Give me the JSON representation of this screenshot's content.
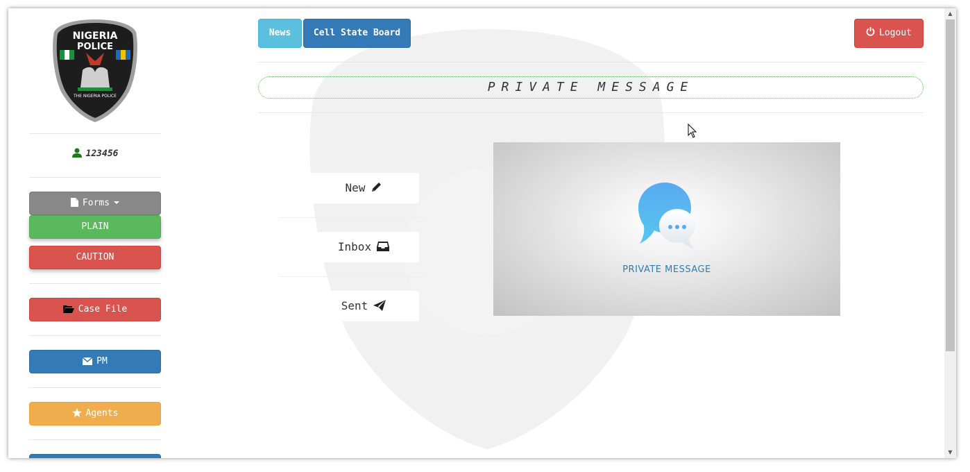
{
  "sidebar": {
    "user_id": "123456",
    "forms_label": "Forms",
    "forms_items": [
      "PLAIN",
      "CAUTION"
    ],
    "case_file_label": "Case File",
    "pm_label": "PM",
    "agents_label": "Agents",
    "logo_text_top": "NIGERIA",
    "logo_text_mid": "POLICE",
    "logo_text_bottom": "THE NIGERIA POLICE"
  },
  "topbar": {
    "news_label": "News",
    "cell_state_board_label": "Cell State Board",
    "logout_label": "Logout"
  },
  "main": {
    "title": "PRIVATE MESSAGE",
    "links": [
      {
        "label": "New",
        "icon": "pencil-icon"
      },
      {
        "label": "Inbox",
        "icon": "inbox-icon"
      },
      {
        "label": "Sent",
        "icon": "send-icon"
      }
    ],
    "image_caption": "PRIVATE MESSAGE"
  },
  "colors": {
    "green": "#5cb85c",
    "red": "#d9534f",
    "blue": "#337ab7",
    "orange": "#f0ad4e",
    "info": "#5bc0de",
    "grey": "#888888"
  }
}
